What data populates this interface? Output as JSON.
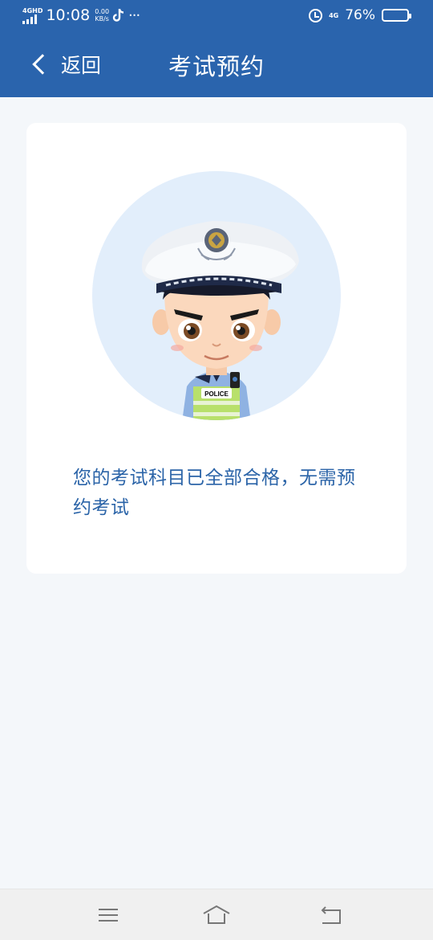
{
  "status_bar": {
    "network_tag": "4GHD",
    "time": "10:08",
    "speed_value": "0.00",
    "speed_unit": "KB/s",
    "more": "···",
    "net_right": "4G",
    "battery": "76%",
    "battery_level": 0.76
  },
  "header": {
    "back_label": "返回",
    "title": "考试预约"
  },
  "card": {
    "badge_text": "POLICE",
    "message": "您的考试科目已全部合格，无需预约考试"
  },
  "colors": {
    "header_bg": "#2a64ad",
    "message_text": "#2b64a8",
    "avatar_circle": "#e2eefb",
    "page_bg": "#f4f7fa"
  },
  "icons": [
    "tiktok-icon",
    "alarm-icon",
    "battery-icon",
    "back-chevron-icon",
    "menu-icon",
    "home-icon",
    "back-icon"
  ]
}
